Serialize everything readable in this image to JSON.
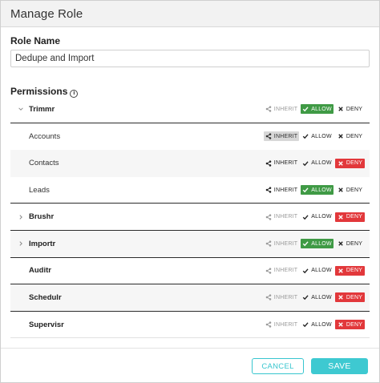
{
  "dialog": {
    "title": "Manage Role"
  },
  "role_name": {
    "label": "Role Name",
    "value": "Dedupe and Import"
  },
  "permissions": {
    "label": "Permissions",
    "info_glyph": "i",
    "option_labels": {
      "inherit": "INHERIT",
      "allow": "ALLOW",
      "deny": "DENY"
    },
    "rows": [
      {
        "label": "Trimmr",
        "level": "parent",
        "expander": "chevron-down-icon",
        "selected": "allow",
        "inherit_enabled": false
      },
      {
        "label": "Accounts",
        "level": "child",
        "expander": "",
        "selected": "inherit",
        "inherit_enabled": true
      },
      {
        "label": "Contacts",
        "level": "child",
        "expander": "",
        "selected": "deny",
        "inherit_enabled": true
      },
      {
        "label": "Leads",
        "level": "child",
        "expander": "",
        "selected": "allow",
        "inherit_enabled": true
      },
      {
        "label": "Brushr",
        "level": "parent",
        "expander": "chevron-right-icon",
        "selected": "deny",
        "inherit_enabled": false
      },
      {
        "label": "Importr",
        "level": "parent",
        "expander": "chevron-right-icon",
        "selected": "allow",
        "inherit_enabled": false
      },
      {
        "label": "Auditr",
        "level": "parent",
        "expander": "",
        "selected": "deny",
        "inherit_enabled": false
      },
      {
        "label": "Schedulr",
        "level": "parent",
        "expander": "",
        "selected": "deny",
        "inherit_enabled": false
      },
      {
        "label": "Supervisr",
        "level": "parent",
        "expander": "",
        "selected": "deny",
        "inherit_enabled": false
      }
    ]
  },
  "footer": {
    "cancel_label": "CANCEL",
    "save_label": "SAVE"
  },
  "colors": {
    "allow_selected": "#3f9a45",
    "deny_selected": "#e2383b",
    "inherit_selected": "#d7d7d7",
    "accent": "#3ec9d1",
    "header_bg": "#f2f2f2"
  }
}
